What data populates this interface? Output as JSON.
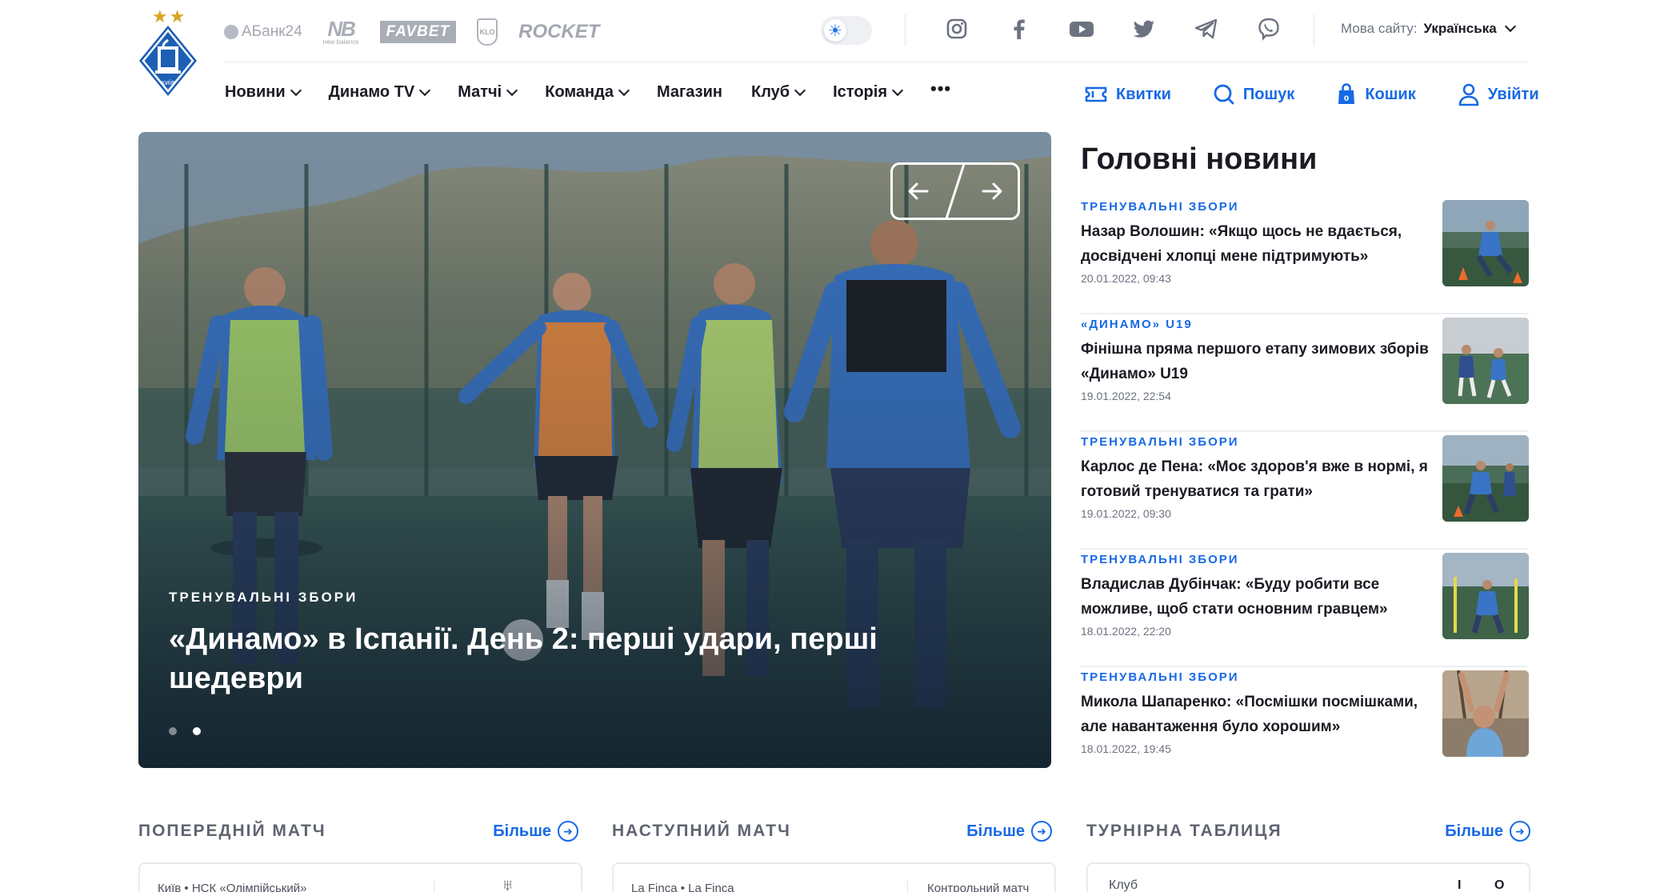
{
  "header": {
    "sponsors": [
      "АБанк24",
      "new balance",
      "FAVBET",
      "KLO",
      "ROCKET"
    ],
    "language_label": "Мова сайту:",
    "language_value": "Українська"
  },
  "nav": [
    {
      "label": "Новини",
      "dropdown": true
    },
    {
      "label": "Динамо TV",
      "dropdown": true
    },
    {
      "label": "Матчі",
      "dropdown": true
    },
    {
      "label": "Команда",
      "dropdown": true
    },
    {
      "label": "Магазин",
      "dropdown": false
    },
    {
      "label": "Клуб",
      "dropdown": true
    },
    {
      "label": "Історія",
      "dropdown": true
    },
    {
      "label": "•••",
      "dropdown": false
    }
  ],
  "actions": {
    "tickets": "Квитки",
    "search": "Пошук",
    "cart": "Кошик",
    "login": "Увійти"
  },
  "hero": {
    "category": "ТРЕНУВАЛЬНІ ЗБОРИ",
    "title": "«Динамо» в Іспанії. День 2: перші удари, перші шедеври"
  },
  "main_news": {
    "title": "Головні новини",
    "items": [
      {
        "category": "ТРЕНУВАЛЬНІ ЗБОРИ",
        "title": "Назар Волошин: «Якщо щось не вдається, досвідчені хлопці мене підтримують»",
        "date": "20.01.2022, 09:43"
      },
      {
        "category": "«ДИНАМО» U19",
        "title": "Фінішна пряма першого етапу зимових зборів «Динамо» U19",
        "date": "19.01.2022, 22:54"
      },
      {
        "category": "ТРЕНУВАЛЬНІ ЗБОРИ",
        "title": "Карлос де Пена: «Моє здоров'я вже в нормі, я готовий тренуватися та грати»",
        "date": "19.01.2022, 09:30"
      },
      {
        "category": "ТРЕНУВАЛЬНІ ЗБОРИ",
        "title": "Владислав Дубінчак: «Буду робити все можливе, щоб стати основним гравцем»",
        "date": "18.01.2022, 22:20"
      },
      {
        "category": "ТРЕНУВАЛЬНІ ЗБОРИ",
        "title": "Микола Шапаренко: «Посмішки посмішками, але навантаження було хорошим»",
        "date": "18.01.2022, 19:45"
      }
    ]
  },
  "blocks": {
    "previous": {
      "title": "ПОПЕРЕДНІЙ МАТЧ",
      "more": "Більше",
      "location": "Київ • НСК «Олімпійський»"
    },
    "next": {
      "title": "НАСТУПНИЙ МАТЧ",
      "more": "Більше",
      "location": "La Finca • La Finca",
      "type": "Контрольний матч"
    },
    "table": {
      "title": "ТУРНІРНА ТАБЛИЦЯ",
      "more": "Більше",
      "col_club": "Клуб",
      "col_i": "І",
      "col_o": "О"
    }
  },
  "colors": {
    "accent": "#1769e5",
    "logo_blue": "#1d5fb4",
    "star": "#d8a422"
  }
}
